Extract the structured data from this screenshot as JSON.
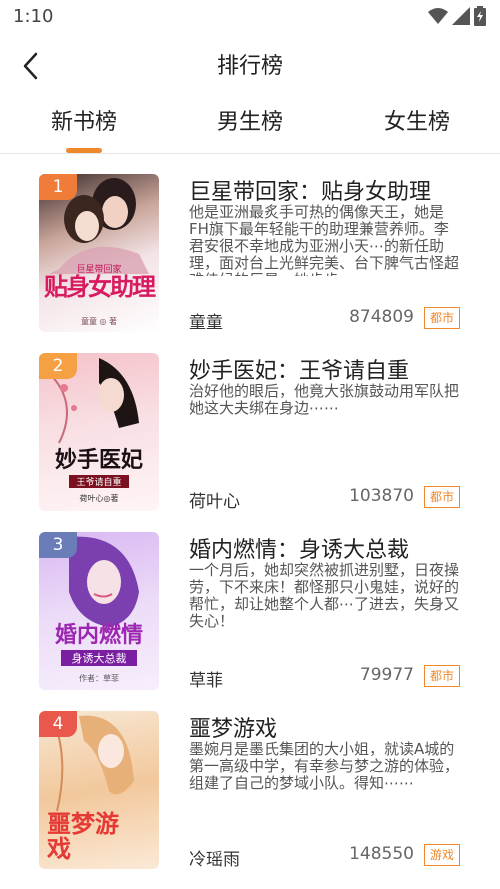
{
  "status_bar": {
    "time": "1:10"
  },
  "header": {
    "title": "排行榜"
  },
  "tabs": [
    {
      "label": "新书榜",
      "active": true
    },
    {
      "label": "男生榜",
      "active": false
    },
    {
      "label": "女生榜",
      "active": false
    }
  ],
  "colors": {
    "accent": "#f0892d"
  },
  "books": [
    {
      "rank": "1",
      "title": "巨星带回家：贴身女助理",
      "description": "他是亚洲最炙手可热的偶像天王，她是FH旗下最年轻能干的助理兼营养师。李君安很不幸地成为亚洲小天⋯的新任助理，面对台上光鲜完美、台下脾气古怪超难侍候的巨星，她步步",
      "author": "童童",
      "count": "874809",
      "tag": "都市",
      "cover": {
        "title": "贴身女助理",
        "subtitle": "巨星带回家",
        "author": "童童 ◎ 著"
      }
    },
    {
      "rank": "2",
      "title": "妙手医妃：王爷请自重",
      "description": "治好他的眼后，他竟大张旗鼓动用军队把她这大夫绑在身边⋯⋯",
      "author": "荷叶心",
      "count": "103870",
      "tag": "都市",
      "cover": {
        "title": "妙手医妃",
        "subtitle": "王爷请自重",
        "author": "荷叶心◎著"
      }
    },
    {
      "rank": "3",
      "title": "婚内燃情：身诱大总裁",
      "description": "一个月后，她却突然被抓进别墅，日夜操劳，下不来床！都怪那只小鬼娃，说好的帮忙，却让她整个人都⋯了进去，失身又失心！",
      "author": "草菲",
      "count": "79977",
      "tag": "都市",
      "cover": {
        "title": "婚内燃情",
        "subtitle": "身诱大总裁",
        "author": "作者：草菲"
      }
    },
    {
      "rank": "4",
      "title": "噩梦游戏",
      "description": "墨婉月是墨氏集团的大小姐，就读A城的第一高级中学，有幸参与梦之游的体验，组建了自己的梦域小队。得知⋯⋯",
      "author": "冷瑶雨",
      "count": "148550",
      "tag": "游戏",
      "cover": {
        "title": "噩梦游戏",
        "subtitle": "",
        "author": ""
      }
    }
  ]
}
